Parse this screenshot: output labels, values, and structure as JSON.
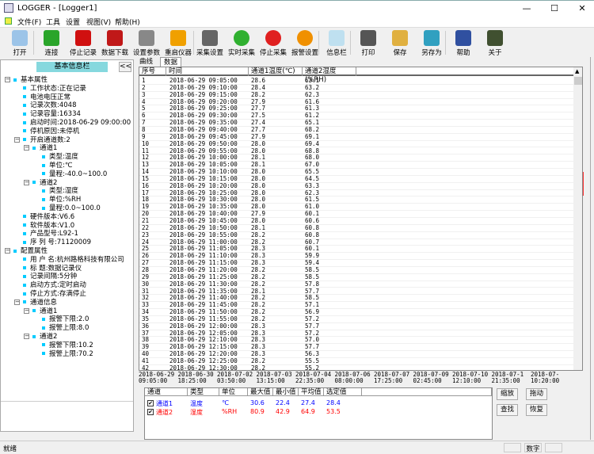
{
  "window": {
    "title": "LOGGER - [Logger1]",
    "minimize": "—",
    "maximize": "☐",
    "close": "✕"
  },
  "menu": [
    "文件(F)",
    "工具",
    "设置",
    "视图(V)",
    "帮助(H)"
  ],
  "toolbar": [
    {
      "label": "打开",
      "icon": "folder-icon",
      "color": "#9cc4e8"
    },
    {
      "label": "连接",
      "icon": "refresh-icon",
      "color": "#2aa52a"
    },
    {
      "label": "停止记录",
      "icon": "stop-record-icon",
      "color": "#d01010"
    },
    {
      "label": "数据下载",
      "icon": "download-icon",
      "color": "#c01818"
    },
    {
      "label": "设置参数",
      "icon": "tools-icon",
      "color": "#888888"
    },
    {
      "label": "重启仪器",
      "icon": "power-icon",
      "color": "#f0a000"
    },
    {
      "label": "采集设置",
      "icon": "gear-icon",
      "color": "#666666"
    },
    {
      "label": "实时采集",
      "icon": "plus-icon",
      "color": "#30b030"
    },
    {
      "label": "停止采集",
      "icon": "minus-icon",
      "color": "#e02020"
    },
    {
      "label": "报警设置",
      "icon": "alert-icon",
      "color": "#f09000"
    },
    {
      "label": "信息栏",
      "icon": "info-panel-icon",
      "color": "#bfe0f0"
    },
    {
      "label": "打印",
      "icon": "print-icon",
      "color": "#555555"
    },
    {
      "label": "保存",
      "icon": "save-icon",
      "color": "#e0b040"
    },
    {
      "label": "另存为",
      "icon": "save-as-icon",
      "color": "#30a0c0"
    },
    {
      "label": "帮助",
      "icon": "help-icon",
      "color": "#3050a0"
    },
    {
      "label": "关于",
      "icon": "about-icon",
      "color": "#405030"
    }
  ],
  "left_panel": {
    "title": "基本信息栏",
    "collapse": "<<",
    "tree": [
      {
        "level": 0,
        "text": "基本属性",
        "expander": "−"
      },
      {
        "level": 1,
        "text": "工作状态:正在记录"
      },
      {
        "level": 1,
        "text": "电池电压正常"
      },
      {
        "level": 1,
        "text": "记录次数:4048"
      },
      {
        "level": 1,
        "text": "记录容量:16334"
      },
      {
        "level": 1,
        "text": "启动时间:2018-06-29 09:00:00"
      },
      {
        "level": 1,
        "text": "停机原因:未停机"
      },
      {
        "level": 1,
        "text": "开启通道数:2",
        "expander": "−"
      },
      {
        "level": 2,
        "text": "通道1",
        "expander": "−"
      },
      {
        "level": 3,
        "text": "类型:温度"
      },
      {
        "level": 3,
        "text": "单位:℃"
      },
      {
        "level": 3,
        "text": "量程:-40.0~100.0"
      },
      {
        "level": 2,
        "text": "通道2",
        "expander": "−"
      },
      {
        "level": 3,
        "text": "类型:湿度"
      },
      {
        "level": 3,
        "text": "单位:%RH"
      },
      {
        "level": 3,
        "text": "量程:0.0~100.0"
      },
      {
        "level": 1,
        "text": "硬件版本:V6.6"
      },
      {
        "level": 1,
        "text": "软件版本:V1.0"
      },
      {
        "level": 1,
        "text": "产品型号:L92-1"
      },
      {
        "level": 1,
        "text": "序 列 号:71120009"
      },
      {
        "level": 0,
        "text": "配置属性",
        "expander": "−"
      },
      {
        "level": 1,
        "text": "用 户 名:杭州路格科技有限公司"
      },
      {
        "level": 1,
        "text": "标    题:数据记录仪"
      },
      {
        "level": 1,
        "text": "记录间隔:5分钟"
      },
      {
        "level": 1,
        "text": "启动方式:定时启动"
      },
      {
        "level": 1,
        "text": "停止方式:存满停止"
      },
      {
        "level": 1,
        "text": "通道信息",
        "expander": "−"
      },
      {
        "level": 2,
        "text": "通道1",
        "expander": "−"
      },
      {
        "level": 3,
        "text": "报警下限:2.0"
      },
      {
        "level": 3,
        "text": "报警上限:8.0"
      },
      {
        "level": 2,
        "text": "通道2",
        "expander": "−"
      },
      {
        "level": 3,
        "text": "报警下限:10.2"
      },
      {
        "level": 3,
        "text": "报警上限:70.2"
      }
    ]
  },
  "tabs": [
    "曲线",
    "数据"
  ],
  "table": {
    "headers": [
      "序号",
      "时间",
      "通道1温度(℃)",
      "通道2湿度(%RH)"
    ],
    "rows": [
      [
        "1",
        "2018-06-29 09:05:00",
        "28.6",
        "63.1"
      ],
      [
        "2",
        "2018-06-29 09:10:00",
        "28.4",
        "63.2"
      ],
      [
        "3",
        "2018-06-29 09:15:00",
        "28.2",
        "62.3"
      ],
      [
        "4",
        "2018-06-29 09:20:00",
        "27.9",
        "61.6"
      ],
      [
        "5",
        "2018-06-29 09:25:00",
        "27.7",
        "61.3"
      ],
      [
        "6",
        "2018-06-29 09:30:00",
        "27.5",
        "61.2"
      ],
      [
        "7",
        "2018-06-29 09:35:00",
        "27.4",
        "65.1"
      ],
      [
        "8",
        "2018-06-29 09:40:00",
        "27.7",
        "68.2"
      ],
      [
        "9",
        "2018-06-29 09:45:00",
        "27.9",
        "69.1"
      ],
      [
        "10",
        "2018-06-29 09:50:00",
        "28.0",
        "69.4"
      ],
      [
        "11",
        "2018-06-29 09:55:00",
        "28.0",
        "68.8"
      ],
      [
        "12",
        "2018-06-29 10:00:00",
        "28.1",
        "68.0"
      ],
      [
        "13",
        "2018-06-29 10:05:00",
        "28.1",
        "67.0"
      ],
      [
        "14",
        "2018-06-29 10:10:00",
        "28.0",
        "65.5"
      ],
      [
        "15",
        "2018-06-29 10:15:00",
        "28.0",
        "64.5"
      ],
      [
        "16",
        "2018-06-29 10:20:00",
        "28.0",
        "63.3"
      ],
      [
        "17",
        "2018-06-29 10:25:00",
        "28.0",
        "62.3"
      ],
      [
        "18",
        "2018-06-29 10:30:00",
        "28.0",
        "61.5"
      ],
      [
        "19",
        "2018-06-29 10:35:00",
        "28.0",
        "61.0"
      ],
      [
        "20",
        "2018-06-29 10:40:00",
        "27.9",
        "60.1"
      ],
      [
        "21",
        "2018-06-29 10:45:00",
        "28.0",
        "60.6"
      ],
      [
        "22",
        "2018-06-29 10:50:00",
        "28.1",
        "60.8"
      ],
      [
        "23",
        "2018-06-29 10:55:00",
        "28.2",
        "60.8"
      ],
      [
        "24",
        "2018-06-29 11:00:00",
        "28.2",
        "60.7"
      ],
      [
        "25",
        "2018-06-29 11:05:00",
        "28.3",
        "60.1"
      ],
      [
        "26",
        "2018-06-29 11:10:00",
        "28.3",
        "59.9"
      ],
      [
        "27",
        "2018-06-29 11:15:00",
        "28.3",
        "59.4"
      ],
      [
        "28",
        "2018-06-29 11:20:00",
        "28.2",
        "58.5"
      ],
      [
        "29",
        "2018-06-29 11:25:00",
        "28.2",
        "58.5"
      ],
      [
        "30",
        "2018-06-29 11:30:00",
        "28.2",
        "57.8"
      ],
      [
        "31",
        "2018-06-29 11:35:00",
        "28.1",
        "57.7"
      ],
      [
        "32",
        "2018-06-29 11:40:00",
        "28.2",
        "58.5"
      ],
      [
        "33",
        "2018-06-29 11:45:00",
        "28.2",
        "57.1"
      ],
      [
        "34",
        "2018-06-29 11:50:00",
        "28.2",
        "56.9"
      ],
      [
        "35",
        "2018-06-29 11:55:00",
        "28.2",
        "57.2"
      ],
      [
        "36",
        "2018-06-29 12:00:00",
        "28.3",
        "57.7"
      ],
      [
        "37",
        "2018-06-29 12:05:00",
        "28.3",
        "57.2"
      ],
      [
        "38",
        "2018-06-29 12:10:00",
        "28.3",
        "57.0"
      ],
      [
        "39",
        "2018-06-29 12:15:00",
        "28.3",
        "57.7"
      ],
      [
        "40",
        "2018-06-29 12:20:00",
        "28.3",
        "56.3"
      ],
      [
        "41",
        "2018-06-29 12:25:00",
        "28.2",
        "55.5"
      ],
      [
        "42",
        "2018-06-29 12:30:00",
        "28.2",
        "55.2"
      ]
    ]
  },
  "time_axis": [
    [
      "2018-06-29",
      "09:05:00"
    ],
    [
      "2018-06-30",
      "18:25:00"
    ],
    [
      "2018-07-02",
      "03:50:00"
    ],
    [
      "2018-07-03",
      "13:15:00"
    ],
    [
      "2018-07-04",
      "22:35:00"
    ],
    [
      "2018-07-06",
      "08:00:00"
    ],
    [
      "2018-07-07",
      "17:25:00"
    ],
    [
      "2018-07-09",
      "02:45:00"
    ],
    [
      "2018-07-10",
      "12:10:00"
    ],
    [
      "2018-07-1",
      "21:35:00"
    ],
    [
      "2018-07-",
      "10:20:00"
    ]
  ],
  "channels": {
    "headers": [
      "通道",
      "类型",
      "单位",
      "最大值",
      "最小值",
      "平均值",
      "选定值"
    ],
    "rows": [
      {
        "checked": true,
        "color": "#0000ff",
        "cells": [
          "通道1",
          "温度",
          "℃",
          "30.6",
          "22.4",
          "27.4",
          "28.4"
        ]
      },
      {
        "checked": true,
        "color": "#ff0000",
        "cells": [
          "通道2",
          "湿度",
          "%RH",
          "80.9",
          "42.9",
          "64.9",
          "53.5"
        ]
      }
    ]
  },
  "buttons": {
    "zoom": "缩放",
    "drag": "拖动",
    "find": "查找",
    "restore": "恢复"
  },
  "status": {
    "left": "就绪",
    "num": "数字"
  }
}
